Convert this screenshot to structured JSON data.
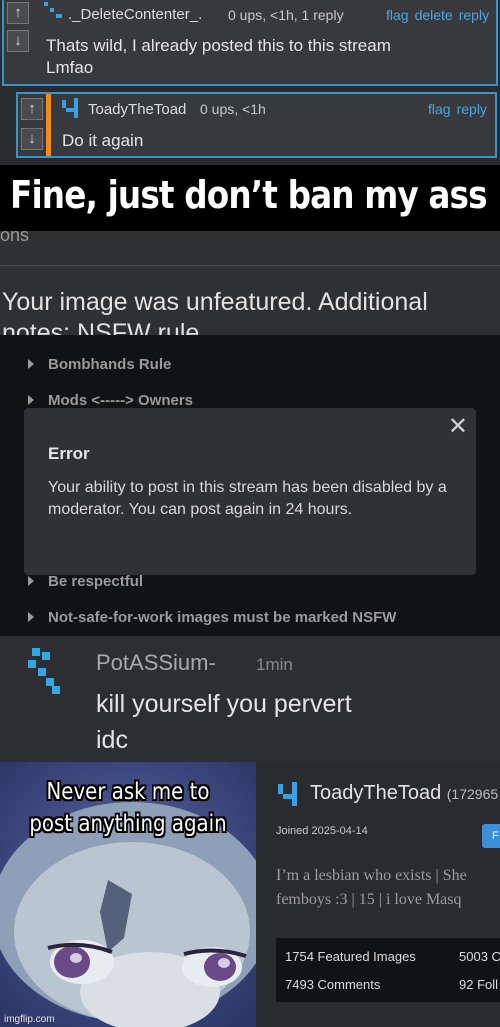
{
  "thread": {
    "comment1": {
      "username": "._DeleteContenter_.",
      "meta": "0 ups, <1h, 1 reply",
      "actions": [
        "flag",
        "delete",
        "reply"
      ],
      "text_lines": [
        "Thats wild, I already posted this to this stream",
        "Lmfao"
      ]
    },
    "comment2": {
      "username": "ToadyTheToad",
      "meta": "0 ups, <1h",
      "actions": [
        "flag",
        "reply"
      ],
      "text": "Do it again"
    },
    "vote_up": "↑",
    "vote_down": "↓"
  },
  "caption1": "Fine, just don’t ban my ass",
  "unfeatured": {
    "top_clip": "ons",
    "message_lines": [
      "Your image was unfeatured. Additional",
      "notes: NSFW rule"
    ]
  },
  "rules": {
    "items_top": [
      "Bombhands Rule",
      "Mods <-----> Owners"
    ],
    "items_bottom": [
      "Be respectful",
      "Not-safe-for-work images must be marked NSFW"
    ]
  },
  "error_dialog": {
    "close": "✕",
    "title": "Error",
    "body": "Your ability to post in this stream has been disabled by a moderator. You can post again in 24 hours."
  },
  "reply": {
    "username": "PotASSium-",
    "time": "1min",
    "text_lines": [
      "kill yourself you pervert",
      "idc"
    ]
  },
  "meme": {
    "caption_lines": [
      "Never ask me to",
      "post anything again"
    ],
    "watermark": "imgflip.com"
  },
  "profile": {
    "username": "ToadyTheToad",
    "rep": "(172965",
    "joined": "Joined 2025-04-14",
    "follow_button": "F",
    "bio_lines": [
      "I’m a lesbian who exists | She",
      "femboys :3 | 15 | i love Masq"
    ],
    "stats": {
      "featured": "1754 Featured Images",
      "comments": "7493 Comments",
      "col2_row1": "5003 C",
      "col2_row2": "92 Foll"
    }
  },
  "colors": {
    "accent_blue": "#3a93c9",
    "link_blue": "#4aa7e6",
    "accent_orange": "#f08a1b",
    "icon_blue": "#3aa0e0"
  },
  "icons": [
    "arrow-up-icon",
    "arrow-down-icon",
    "user-icon",
    "chevron-right-icon",
    "close-icon"
  ]
}
